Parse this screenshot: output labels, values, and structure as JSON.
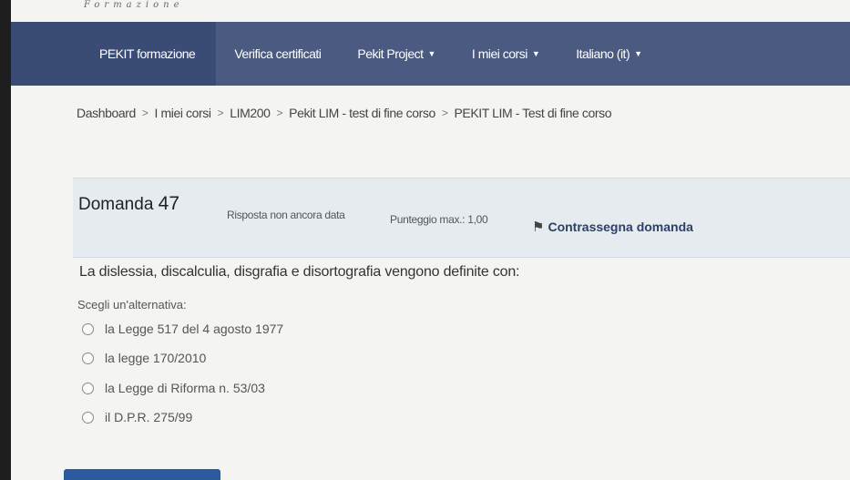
{
  "logo": {
    "text": "Formazione"
  },
  "nav": {
    "brand": "PEKIT formazione",
    "items": [
      {
        "label": "Verifica certificati",
        "dropdown": false
      },
      {
        "label": "Pekit Project",
        "dropdown": true
      },
      {
        "label": "I miei corsi",
        "dropdown": true
      },
      {
        "label": "Italiano (it)",
        "dropdown": true
      }
    ],
    "caret": "▼"
  },
  "breadcrumb": {
    "separator": ">",
    "items": [
      "Dashboard",
      "I miei corsi",
      "LIM200",
      "Pekit LIM - test di fine corso",
      "PEKIT LIM - Test di fine corso"
    ]
  },
  "question": {
    "label": "Domanda",
    "number": "47",
    "status": "Risposta non ancora data",
    "max_score": "Punteggio max.: 1,00",
    "flag_label": "Contrassegna domanda",
    "text": "La dislessia, discalculia, disgrafia e disortografia vengono definite con:",
    "prompt": "Scegli un'alternativa:",
    "answers": [
      "la Legge 517 del 4 agosto 1977",
      "la legge 170/2010",
      "la Legge di Riforma n. 53/03",
      "il D.P.R. 275/99"
    ]
  },
  "colors": {
    "navbar": "#4a5a80",
    "brand_bg": "#3a4b76",
    "question_header": "#e6ebf0",
    "flag_text": "#2d3f66",
    "button": "#2c5aa0"
  }
}
